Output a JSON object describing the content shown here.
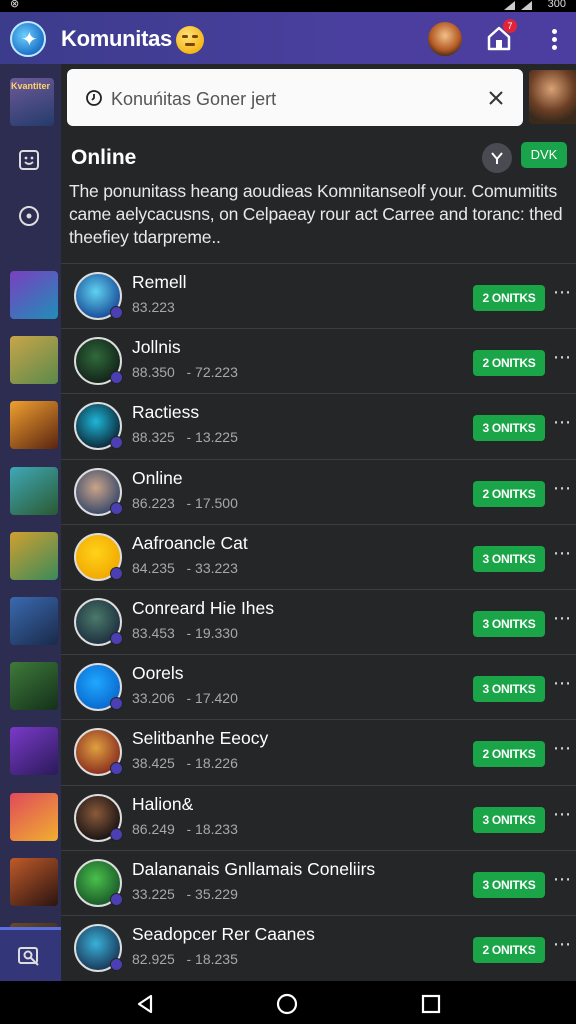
{
  "status_bar": {
    "left": "⊗",
    "right": "300"
  },
  "app_bar": {
    "title": "Komunitas",
    "badge_count": "7"
  },
  "search": {
    "text": "Konuńitas Goner jert"
  },
  "rail": {
    "card_label": "Kvantiter"
  },
  "section": {
    "title": "Online",
    "button_label": "DVK"
  },
  "description": "The ponunitass heang aoudieas Komnitanseolf your. Comumitits came aelycacusns, on Celpaeay rour act Carree and toranc: thed theefiey tdarpreme..",
  "list": [
    {
      "name": "Remell",
      "meta": "83.223",
      "action": "2 ONITKS",
      "colors": [
        "#5fd2f0",
        "#1a4e9a"
      ],
      "rail": [
        "#7a3fc0",
        "#1f8fb8"
      ]
    },
    {
      "name": "Jollnis",
      "meta": "88.350   - 72.223",
      "action": "2 ONITKS",
      "colors": [
        "#2f6a3a",
        "#13231a"
      ],
      "rail": [
        "#c9a54a",
        "#5a8a4a"
      ]
    },
    {
      "name": "Ractiess",
      "meta": "88.325   - 13.225",
      "action": "3 ONITKS",
      "colors": [
        "#1fb6d8",
        "#0c2a3a"
      ],
      "rail": [
        "#f0a030",
        "#5a2410"
      ]
    },
    {
      "name": "Online",
      "meta": "86.223   - 17.500",
      "action": "2 ONITKS",
      "colors": [
        "#c9a48a",
        "#3a4a6a"
      ],
      "rail": [
        "#3fa8b8",
        "#2a5a30"
      ]
    },
    {
      "name": "Aafroancle Cat",
      "meta": "84.235   - 33.223",
      "action": "3 ONITKS",
      "colors": [
        "#ffd21a",
        "#f2a900"
      ],
      "rail": [
        "#d0a030",
        "#3a8a5a"
      ]
    },
    {
      "name": "Conreard Hie Ihes",
      "meta": "83.453   - 19.330",
      "action": "3 ONITKS",
      "colors": [
        "#4a7a6a",
        "#1e3040"
      ],
      "rail": [
        "#3a6ab0",
        "#1a2a4a"
      ]
    },
    {
      "name": "Oorels",
      "meta": "33.206   - 17.420",
      "action": "3 ONITKS",
      "colors": [
        "#1fa8ff",
        "#0a6ad0"
      ],
      "rail": [
        "#3e7a3a",
        "#14301a"
      ]
    },
    {
      "name": "Selitbanhe Eeocy",
      "meta": "38.425   - 18.226",
      "action": "2 ONITKS",
      "colors": [
        "#e0a040",
        "#8a3020"
      ],
      "rail": [
        "#7a3ac8",
        "#2a1a5a"
      ]
    },
    {
      "name": "Halion&",
      "meta": "86.249   - 18.233",
      "action": "3 ONITKS",
      "colors": [
        "#8a5a3a",
        "#1a1414"
      ],
      "rail": [
        "#e04a5a",
        "#f0b030"
      ]
    },
    {
      "name": "Dalananais Gnllamais Coneliirs",
      "meta": "33.225   - 35.229",
      "action": "3 ONITKS",
      "colors": [
        "#4ac04a",
        "#1a5a2a"
      ],
      "rail": [
        "#c05a2a",
        "#2a1410"
      ]
    },
    {
      "name": "Seadopcer Rer Caanes",
      "meta": "82.925   - 18.235",
      "action": "2 ONITKS",
      "colors": [
        "#3ab0d8",
        "#1a3a5a"
      ],
      "rail": [
        "#6a4a2a",
        "#1a1a1a"
      ]
    }
  ]
}
